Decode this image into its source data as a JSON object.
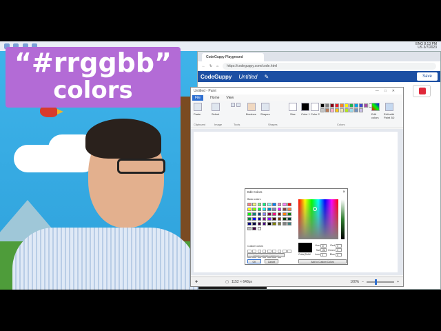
{
  "title_badge": {
    "line1": "“#rrggbb”",
    "line2": "colors"
  },
  "taskbar": {
    "lang": "ENG",
    "region": "US",
    "time": "8:13 PM",
    "date": "3/7/2023"
  },
  "browser": {
    "tab_title": "CodeGuppy Playground",
    "url": "https://codeguppy.com/code.html",
    "app_name": "CodeGuppy",
    "doc_name": "Untitled",
    "save_label": "Save"
  },
  "paint": {
    "window_title": "Untitled - Paint",
    "menu": [
      "File",
      "Home",
      "View"
    ],
    "groups": [
      "Clipboard",
      "Image",
      "Tools",
      "Shapes",
      "Colors"
    ],
    "tools": {
      "paste": "Paste",
      "select": "Select",
      "brushes": "Brushes",
      "shapes": "Shapes",
      "size": "Size",
      "color1": "Color 1",
      "color2": "Color 2",
      "edit_colors": "Edit colors",
      "edit_3d": "Edit with Paint 3D"
    },
    "status": {
      "dimensions": "1152 × 648px",
      "zoom": "100%"
    },
    "palette": [
      "#000000",
      "#7f7f7f",
      "#880015",
      "#ed1c24",
      "#ff7f27",
      "#fff200",
      "#22b14c",
      "#00a2e8",
      "#3f48cc",
      "#a349a4",
      "#ffffff",
      "#c3c3c3",
      "#b97a57",
      "#ffaec9",
      "#ffc90e",
      "#efe4b0",
      "#b5e61d",
      "#99d9ea",
      "#7092be",
      "#c8bfe7"
    ]
  },
  "edit_colors": {
    "title": "Edit Colors",
    "basic_label": "Basic colors",
    "custom_label": "Custom colors",
    "add_custom_disabled": "Define Custom Colors >>",
    "ok": "OK",
    "cancel": "Cancel",
    "color_solid": "Color|Solid",
    "add_to_custom": "Add to Custom Colors",
    "fields": {
      "hue_label": "Hue",
      "hue": "37",
      "sat_label": "Sat",
      "sat": "194",
      "lum_label": "Lum",
      "lum": "0",
      "red_label": "Red",
      "red": "0",
      "green_label": "Green",
      "green": "0",
      "blue_label": "Blue",
      "blue": "0"
    },
    "basic_colors": [
      "#ff8080",
      "#ffff80",
      "#80ff80",
      "#00ff80",
      "#80ffff",
      "#0080ff",
      "#ff80c0",
      "#ff80ff",
      "#ff0000",
      "#ffff00",
      "#80ff00",
      "#00ff40",
      "#00ffff",
      "#0080c0",
      "#8080c0",
      "#ff00ff",
      "#804040",
      "#ff8040",
      "#00ff00",
      "#008080",
      "#004080",
      "#8080ff",
      "#800040",
      "#ff0080",
      "#800000",
      "#ff8000",
      "#008000",
      "#008040",
      "#0000ff",
      "#0000a0",
      "#800080",
      "#8000ff",
      "#400000",
      "#804000",
      "#004000",
      "#004040",
      "#000080",
      "#000040",
      "#400040",
      "#400080",
      "#000000",
      "#808000",
      "#808040",
      "#808080",
      "#408080",
      "#c0c0c0",
      "#400040",
      "#ffffff"
    ]
  }
}
